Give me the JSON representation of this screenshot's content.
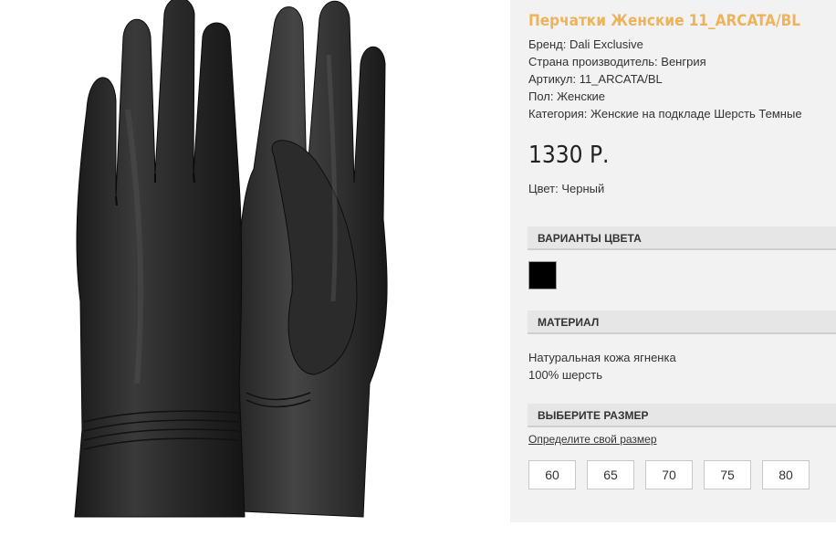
{
  "product": {
    "title": "Перчатки Женские 11_ARCATA/BL",
    "attributes": [
      "Бренд: Dali Exclusive",
      "Страна производитель: Венгрия",
      "Артикул: 11_ARCATA/BL",
      "Пол: Женские",
      "Категория: Женские на подкладе Шерсть Темные"
    ],
    "price": "1330 Р.",
    "color": "Цвет: Черный"
  },
  "color_variants": {
    "header": "ВАРИАНТЫ ЦВЕТА",
    "swatches": [
      {
        "color": "#000000"
      }
    ]
  },
  "material": {
    "header": "МАТЕРИАЛ",
    "lines": [
      "Натуральная кожа ягненка",
      "100% шерсть"
    ]
  },
  "size": {
    "header": "ВЫБЕРИТЕ РАЗМЕР",
    "link": "Определите свой размер",
    "options": [
      "60",
      "65",
      "70",
      "75",
      "80"
    ]
  },
  "colors": {
    "accent": "#eeb35a",
    "panel": "#f2f2f2"
  }
}
